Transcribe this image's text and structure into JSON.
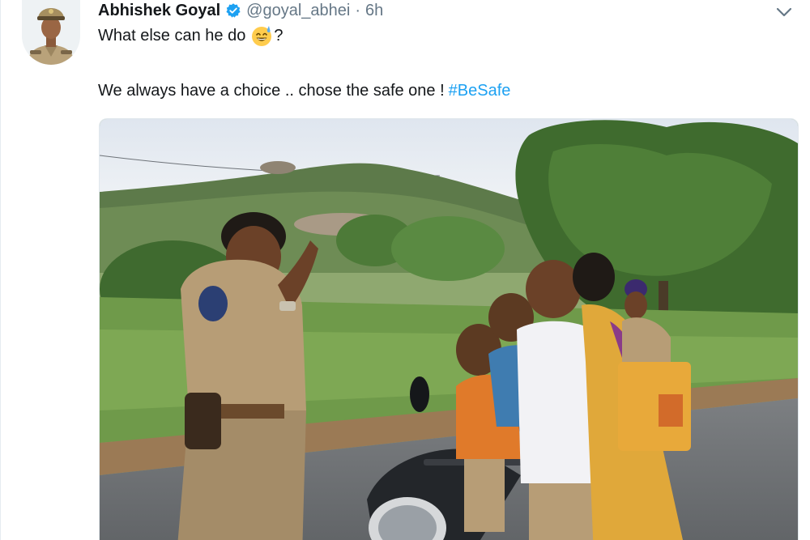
{
  "tweet": {
    "author_name": "Abhishek Goyal",
    "handle": "@goyal_abhei",
    "separator": "·",
    "time": "6h",
    "line1_before": "What else can he do",
    "line1_after": "?",
    "line2_text": "We always have a choice .. chose the safe one !",
    "hashtag": "#BeSafe"
  },
  "colors": {
    "link": "#1da1f2",
    "verified": "#1da1f2",
    "secondary_text": "#657786"
  },
  "icons": {
    "verified": "verified-badge-icon",
    "more": "chevron-down-icon",
    "emoji": "grinning-face-with-sweat-emoji"
  }
}
